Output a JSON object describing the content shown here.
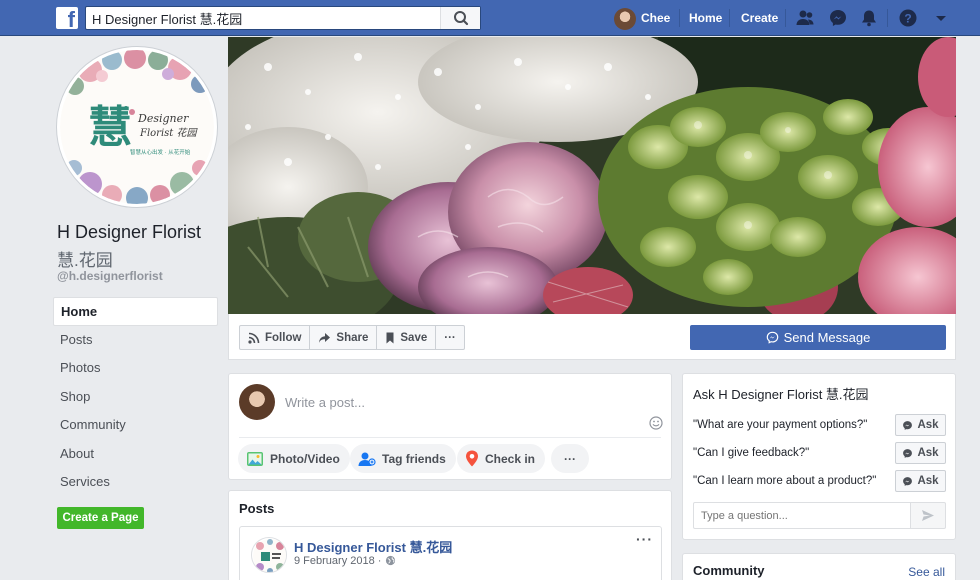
{
  "topbar": {
    "search_value": "H Designer Florist 慧.花园",
    "user_name": "Chee",
    "home_label": "Home",
    "create_label": "Create",
    "brand_color": "#4267b2"
  },
  "page": {
    "name": "H Designer Florist",
    "name_cn": "慧.花园",
    "handle": "@h.designerflorist",
    "logo_big_char": "慧",
    "logo_text_1": "Designer",
    "logo_text_2": "Florist 花园",
    "logo_tagline": "智慧从心出发 · 从花开始"
  },
  "sidebar": {
    "items": [
      {
        "label": "Home",
        "active": true
      },
      {
        "label": "Posts"
      },
      {
        "label": "Photos"
      },
      {
        "label": "Shop"
      },
      {
        "label": "Community"
      },
      {
        "label": "About"
      },
      {
        "label": "Services"
      }
    ],
    "create_page_label": "Create a Page"
  },
  "actions": {
    "follow": "Follow",
    "share": "Share",
    "save": "Save",
    "more": "···",
    "send_message": "Send Message"
  },
  "composer": {
    "placeholder": "Write a post...",
    "photo_video": "Photo/Video",
    "tag_friends": "Tag friends",
    "check_in": "Check in",
    "more": "···"
  },
  "posts": {
    "title": "Posts",
    "first_post": {
      "author": "H Designer Florist 慧.花园",
      "date": "9 February 2018 ·",
      "more": "···"
    }
  },
  "ask": {
    "title": "Ask H Designer Florist 慧.花园",
    "button_label": "Ask",
    "questions": [
      "\"What are your payment options?\"",
      "\"Can I give feedback?\"",
      "\"Can I learn more about a product?\""
    ],
    "input_placeholder": "Type a question..."
  },
  "community": {
    "title": "Community",
    "see_all": "See all"
  }
}
